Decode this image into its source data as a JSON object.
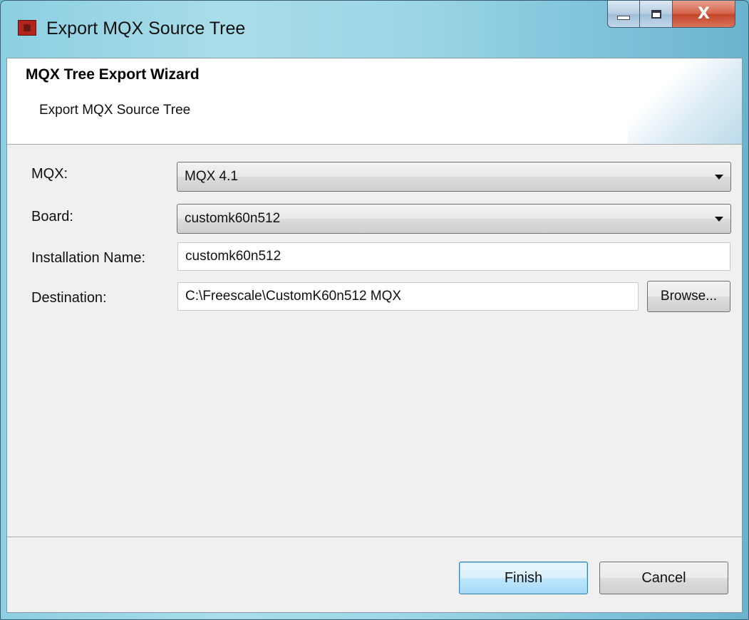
{
  "window": {
    "title": "Export MQX Source Tree",
    "icon": "app-icon",
    "controls": {
      "minimize": "minimize-icon",
      "maximize": "maximize-icon",
      "close_label": "X"
    }
  },
  "header": {
    "title": "MQX Tree Export Wizard",
    "description": "Export MQX Source Tree"
  },
  "form": {
    "mqx": {
      "label": "MQX:",
      "value": "MQX 4.1"
    },
    "board": {
      "label": "Board:",
      "value": "customk60n512"
    },
    "installation_name": {
      "label": "Installation Name:",
      "value": "customk60n512"
    },
    "destination": {
      "label": "Destination:",
      "value": "C:\\Freescale\\CustomK60n512 MQX",
      "browse_label": "Browse..."
    }
  },
  "buttons": {
    "finish": "Finish",
    "cancel": "Cancel"
  },
  "colors": {
    "title_bar": "#9cd6e6",
    "client_background": "#f0f0f0",
    "default_button_border": "#3c7fb1",
    "close_button": "#c4442a"
  }
}
